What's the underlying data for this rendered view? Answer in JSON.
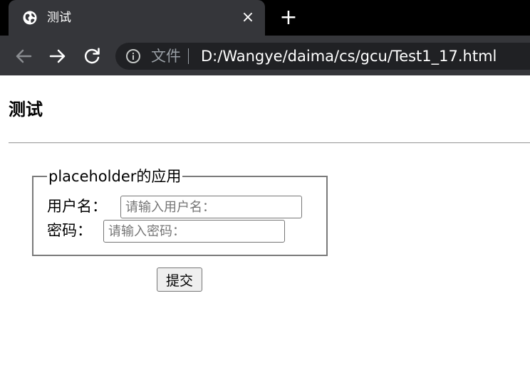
{
  "browser": {
    "tab": {
      "title": "测试",
      "favicon": "globe-icon"
    },
    "new_tab_symbol": "+",
    "close_symbol": "×",
    "address": {
      "scheme_label": "文件",
      "url": "D:/Wangye/daima/cs/gcu/Test1_17.html"
    }
  },
  "page": {
    "heading": "测试",
    "form": {
      "legend": "placeholder的应用",
      "username": {
        "label": "用户名：",
        "placeholder": "请输入用户名："
      },
      "password": {
        "label": "密码：",
        "placeholder": "请输入密码："
      },
      "submit_label": "提交"
    }
  },
  "colors": {
    "tabbar_bg": "#000000",
    "toolbar_bg": "#35363a",
    "omnibox_bg": "#202124",
    "fieldset_border": "#7a7a7a"
  }
}
